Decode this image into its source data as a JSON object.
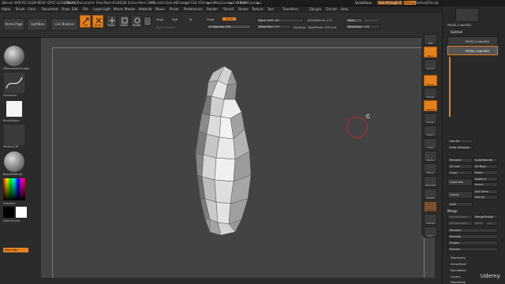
{
  "window": {
    "title": "ZBrush ARM PZ [SSDP-BDVF-QPCF-GZGE-NAAE]",
    "doc": "ZBrush Document",
    "free_mem": "• Free Mem 8.046GB",
    "active_mem": "• Active Mem 1965",
    "scratch": "• Scratch Disk 41",
    "timer": "• Timer▶0.516 ATime▶0.3",
    "polycount": "• PolyCount▶0.942 KP",
    "meshcount": "• MeshCount▶1",
    "quicksave": "QuickSave",
    "see_through": "See-through",
    "see_through_val": "0",
    "menus": "Menus",
    "default_zscript": "DefaultZScript"
  },
  "menu": [
    "Alpha",
    "Brush",
    "Color",
    "Document",
    "Draw",
    "Edit",
    "File",
    "Layer",
    "Light",
    "Macro",
    "Marker",
    "Material",
    "Movie",
    "Picker",
    "Preferences",
    "Render",
    "Stencil",
    "Stroke",
    "Texture",
    "Tool",
    "Transform",
    "Zplugin",
    "Zscript",
    "Help"
  ],
  "toolbar": {
    "home_page": "Home Page",
    "lightbox": "LightBox",
    "live_boolean": "Live Boolean",
    "edit": "Edit",
    "draw": "Draw",
    "move": "Move",
    "scale": "Scale",
    "rotate": "Rotate",
    "mrgb": "Mrgb",
    "rgb": "Rgb",
    "m": "M",
    "rgb_intensity": "Rgb Intensity",
    "zadd": "Zadd",
    "zsub": "Zsub",
    "z_intensity": "Z Intensity 100",
    "focal_shift": "Focal Shift -83",
    "draw_size": "Draw Size 379",
    "dynamic": "Dynamic",
    "active_points": "ActivePoints: 472",
    "total_points": "TotalPoints: 473,414",
    "subdiv": "SDiv",
    "del_lower": "Del Lower",
    "resolution": "Resolution 128"
  },
  "left": {
    "brush_label": "ZRemesherGuides",
    "stroke_label": "FreeHand",
    "alpha_label": "BrushAlpha",
    "texture_label": "Texture Off",
    "material_label": "BasicMaterial",
    "gradient": "Gradient",
    "switch_color": "SwitchColor",
    "alternate": "Alternate"
  },
  "shelf": {
    "bpr": "BPR",
    "spix": "SPix 3",
    "scroll": "Scroll",
    "zoom": "Zoom",
    "actual": "Actual",
    "aahalf": "AAHalf",
    "persp": "Persp",
    "floor": "Floor",
    "local": "L.Sym",
    "frame": "Frame",
    "move": "Move",
    "zoom3d": "Zoom3D",
    "rotate": "Rotate",
    "line_fill": "Line Fill",
    "polyf": "PolyF",
    "transp": "Transp",
    "ghost": "Ghost",
    "solo": "Solo",
    "xpose": "Xpose"
  },
  "right": {
    "tool_name": "PM3D_Cube3D2",
    "subtool": "Subtool",
    "subtool_items": [
      "PM3D_Cube3D1",
      "PM3D_Cube3D2"
    ],
    "list_all": "List All",
    "auto_collapse": "Auto Collapse",
    "rename": "Rename",
    "autoreorder": "AutoReorder",
    "all_low": "All Low",
    "all_high": "All High",
    "copy": "Copy",
    "paste": "Paste",
    "duplicate": "Duplicate",
    "append": "Append",
    "insert": "Insert",
    "delete": "Delete",
    "del_other": "Del Other",
    "del_all": "Del All",
    "split": "Split",
    "merge": "Merge",
    "mergedown": "MergeDown",
    "mergesimilar": "MergeSimilar",
    "mergevisible": "MergeVisible",
    "weld": "Weld",
    "uv": "Uv",
    "boolean": "Boolean",
    "remesh": "Remesh",
    "project": "Project",
    "extract": "Extract",
    "geometry": "Geometry",
    "arraymesh": "ArrayMesh",
    "nanomesh": "NanoMesh",
    "layers": "Layers",
    "fibermesh": "FiberMesh"
  },
  "watermark": "Udemy",
  "colors": {
    "accent": "#e5821e",
    "cursor_ring": "#c0282a",
    "canvas": "#434343"
  }
}
